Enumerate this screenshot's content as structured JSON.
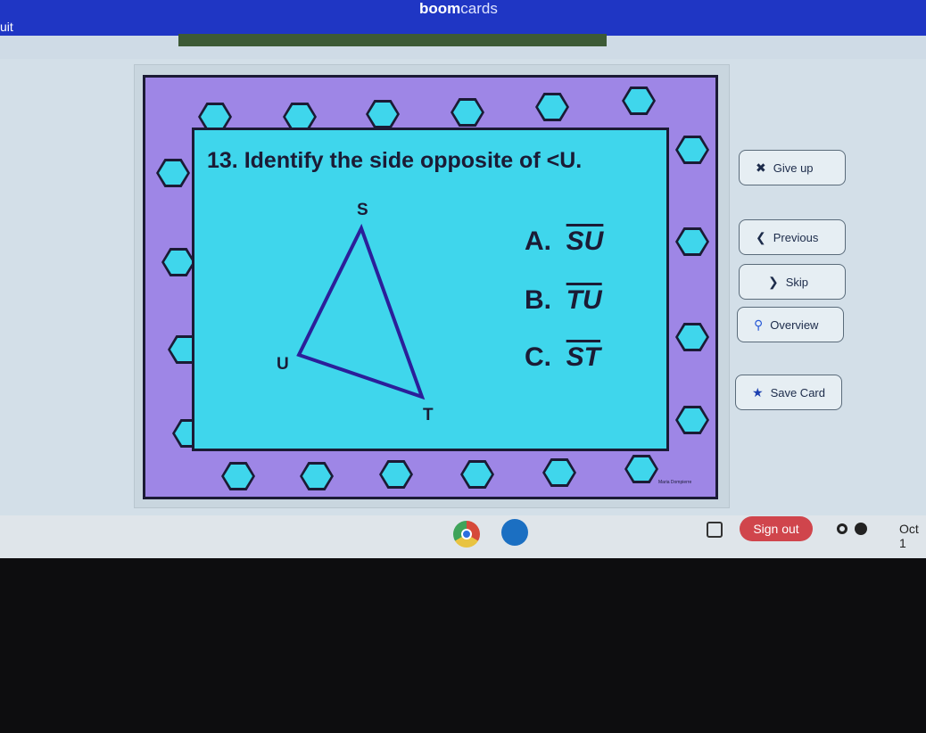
{
  "browser": {
    "tab_fragment": "uit",
    "logo_bold": "boom",
    "logo_light": "cards"
  },
  "question": {
    "text": "13. Identify the side opposite of <U.",
    "options": [
      {
        "letter": "A.",
        "segment": "SU"
      },
      {
        "letter": "B.",
        "segment": "TU"
      },
      {
        "letter": "C.",
        "segment": "ST"
      }
    ],
    "triangle": {
      "vertices": [
        "S",
        "U",
        "T"
      ]
    },
    "credit": "Maria Dompierre"
  },
  "actions": [
    {
      "label": "Give up",
      "icon": "x-icon"
    },
    {
      "label": "Previous",
      "icon": "chevron-left-icon"
    },
    {
      "label": "Skip",
      "icon": "chevron-right-icon"
    },
    {
      "label": "Overview",
      "icon": "search-icon"
    },
    {
      "label": "Save Card",
      "icon": "star-icon"
    }
  ],
  "taskbar": {
    "sign_out": "Sign out",
    "date": "Oct 1"
  },
  "colors": {
    "card_border": "#9e86e6",
    "card_inner": "#3fd6ec",
    "sign_out": "#d0454c",
    "header": "#1f36c4"
  }
}
